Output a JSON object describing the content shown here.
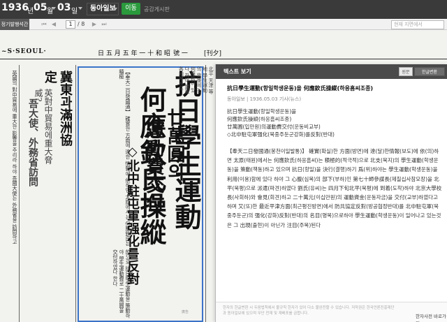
{
  "topbar": {
    "year": "1936",
    "year_unit": "년",
    "month": "05",
    "month_unit": "월",
    "day": "03",
    "day_unit": "일",
    "newspaper": "동아일보",
    "move_button": "이동",
    "notice_link": "공감게시판"
  },
  "toolbar": {
    "tab_label": "정기발행석간",
    "page_current": "1",
    "page_total": "/ 8",
    "search_placeholder": "현재 지면에서"
  },
  "newspaper": {
    "masthead_left": "~S·SEOUL·",
    "masthead_mid": "日 五 月 五 年 一 十 和 昭",
    "masthead_right": "號 一",
    "masthead_right2": "[刊夕]",
    "headline_main_1": "抗日學生運動",
    "headline_main_2": "何應欽氏操縱",
    "headline_sub_1": "廿萬圓의",
    "headline_sub_2": "運動費交付",
    "headline_sub_3": "◇北中駐屯軍强化를反對",
    "left_headline_1": "冀東과滿洲協定",
    "left_headline_2": "英對中貿易에重大脅威?",
    "left_headline_3": "吾大使、外務省訪問",
    "article_fragment_1": "【奉天二日發國通】 確實한 方面에 達한 情報에 依하면 太原에서는 何應欽氏는 積極",
    "article_fragment_2": "的으로 抗日學生運動을 策動하야 學生運動費로 二十萬圓을 交付하였다 한다",
    "side_text": "北平 天津 等地 學生運動의 背後에는 何應欽이 있다 하며 冀東 各地에서도",
    "left_body": "英國의 對中貿易에 重大한 影響을 주리라 하야 吾國大使는 外務省을 訪問하고",
    "bottom_mark": "廣告"
  },
  "panel": {
    "title": "텍스트 보기",
    "btn_original": "원문",
    "btn_convert": "한글변환",
    "article_title": "抗日學生運動(항일학생운동)을 何應欽氏操縱(하응흠씨조종)",
    "meta": "동아일보 | 1936.05.03 기사(뉴스)",
    "subheads": [
      "抗日學生運動(항일학생운동)을",
      "何應欽氏操縱(하응흠씨조종)",
      "廿萬圓(입만원)의運動費交付(운동비교부)",
      "◇北中駐屯軍强化(북중주둔군강화)를反對(반대)"
    ],
    "body": "【奉天二日發國通(봉천이일발통)】 確實(확실)한 方面(방면)에 達(달)한情報(보도)에 依(의)하면 太原(태원)에서는 何應欽氏(하응흠씨)는 積極的(적극적)으로 北支(북지)의 學生運動(학생운동)을 策動(책동)하고 있으며 抗日(항일)을 決行(결행)하기 爲(위)하야는 學生運動(학생운동)을 利用(이용)함에 있다 하야 그 心腹(심복)의 部下(부하)인 第七十師參謀長(제칠십사참모장)을 北平(북평)으로 派遣(파견)하였다 劉氏(유씨)는 四月下旬北平(북평)에 到着(도착)하야 北京大學校長(사회하)와 會見(회견)하고 二十萬元(이십만원)의 運動資金(운동자금)을 交付(교부)하였다고 하며 又(또)한 最近平津方面(최근평진방면)에서 防共協定反對(방공협정반대)를 北中駐屯軍(북중주둔군)의 强化(강화)反對(반대)의 名目(명목)으로하야 學生運動(학생운동)이 일어나고 있는것은 그 出現(출현)이 아닌가 注目(주목)된다",
    "footer_text": "한자의 한글변환 시 두음법칙에서 불규칙 한자가 있어 다소 불완전할 수 있습니다. 저작권은 한국언론진흥재단과 동아일보에 있으며 무단 전재 및 재배포를 금합니다.",
    "footer_link": "한자사전 바로가기"
  }
}
